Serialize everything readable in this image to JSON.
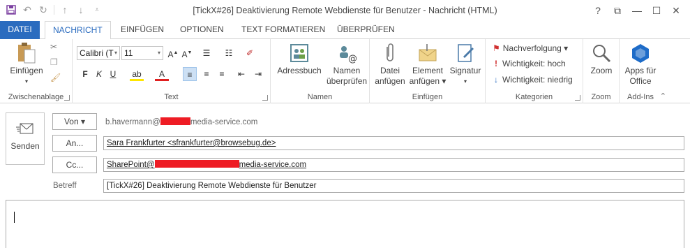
{
  "window": {
    "title": "[TickX#26] Deaktivierung Remote Webdienste für Benutzer - Nachricht (HTML)",
    "controls": [
      "?",
      "⧉",
      "—",
      "☐",
      "✕"
    ]
  },
  "quick_access": [
    "save-icon",
    "undo-icon",
    "redo-icon",
    "up-arrow-icon",
    "down-arrow-icon",
    "customize-icon"
  ],
  "tabs": [
    {
      "label": "DATEI"
    },
    {
      "label": "NACHRICHT"
    },
    {
      "label": "EINFÜGEN"
    },
    {
      "label": "OPTIONEN"
    },
    {
      "label": "TEXT FORMATIEREN"
    },
    {
      "label": "ÜBERPRÜFEN"
    }
  ],
  "ribbon": {
    "clipboard": {
      "label": "Zwischenablage",
      "paste": "Einfügen"
    },
    "basic_text": {
      "label": "Text",
      "font": "Calibri (T",
      "size": "11"
    },
    "names": {
      "label": "Namen",
      "addressbook": "Adressbuch",
      "check1": "Namen",
      "check2": "überprüfen"
    },
    "include": {
      "label": "Einfügen",
      "file1": "Datei",
      "file2": "anfügen",
      "item1": "Element",
      "item2": "anfügen ▾",
      "signature": "Signatur"
    },
    "tags": {
      "label": "Kategorien",
      "followup": "Nachverfolgung ▾",
      "high": "Wichtigkeit: hoch",
      "low": "Wichtigkeit: niedrig"
    },
    "zoom": {
      "label": "Zoom",
      "button": "Zoom"
    },
    "addins": {
      "label": "Add-Ins",
      "apps1": "Apps für",
      "apps2": "Office"
    }
  },
  "compose": {
    "send": "Senden",
    "from_button": "Von ▾",
    "from_prefix": "b.havermann@",
    "from_suffix": "media-service.com",
    "to_button": "An...",
    "to_value": "Sara Frankfurter <sfrankfurter@browsebug.de>",
    "cc_button": "Cc...",
    "cc_prefix": "SharePoint@",
    "cc_suffix": "media-service.com",
    "subject_label": "Betreff",
    "subject_value": "[TickX#26] Deaktivierung Remote Webdienste für Benutzer"
  },
  "colors": {
    "file_tab": "#2b6cbf",
    "redaction": "#ee1c24",
    "accent": "#2b6cbf"
  }
}
